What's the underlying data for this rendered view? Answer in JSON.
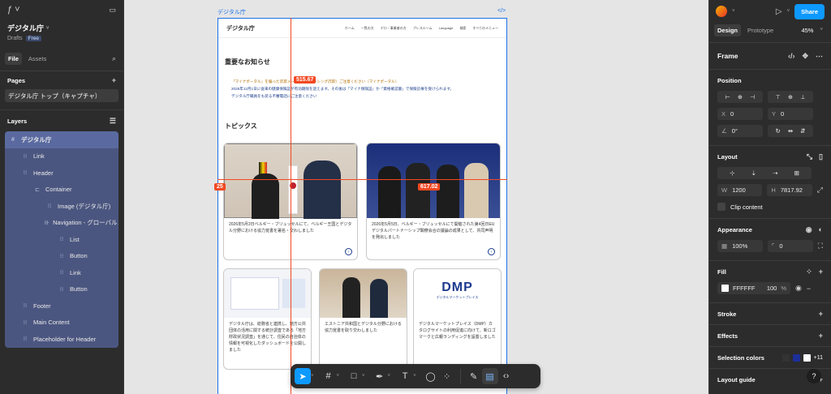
{
  "left": {
    "file_name": "デジタル庁",
    "drafts": "Drafts",
    "plan_badge": "Free",
    "tabs": [
      "File",
      "Assets"
    ],
    "pages_label": "Pages",
    "page_item": "デジタル庁 トップ（キャプチャ）",
    "layers_label": "Layers",
    "layers": [
      {
        "name": "デジタル庁",
        "icon": "#",
        "indent": 0
      },
      {
        "name": "Link",
        "icon": "⁝⁝",
        "indent": 1
      },
      {
        "name": "Header",
        "icon": "⁝⁝",
        "indent": 1
      },
      {
        "name": "Container",
        "icon": "⊏",
        "indent": 2
      },
      {
        "name": "Image (デジタル庁)",
        "icon": "⁝⁝",
        "indent": 3
      },
      {
        "name": "Navigation - グローバルメ",
        "icon": "⊪",
        "indent": 3
      },
      {
        "name": "List",
        "icon": "⁝⁝",
        "indent": 4
      },
      {
        "name": "Button",
        "icon": "⁝⁝",
        "indent": 4
      },
      {
        "name": "Link",
        "icon": "⁝⁝",
        "indent": 4
      },
      {
        "name": "Button",
        "icon": "⁝⁝",
        "indent": 4
      },
      {
        "name": "Footer",
        "icon": "⁝⁝",
        "indent": 1
      },
      {
        "name": "Main Content",
        "icon": "⁝⁝",
        "indent": 1
      },
      {
        "name": "Placeholder for Header",
        "icon": "⁝⁝",
        "indent": 1
      }
    ]
  },
  "canvas": {
    "frame_label": "デジタル庁",
    "code_icon": "</>",
    "measure_top": "515.67",
    "measure_left": "25",
    "measure_right": "617.02",
    "site": {
      "logo": "デジタル庁",
      "nav": [
        "ホーム",
        "一覧の方",
        "デロ・事業者の方",
        "プレスルーム",
        "Language",
        "検索",
        "すべてのメニュー"
      ],
      "notice_heading": "重要なお知らせ",
      "notice_lines": [
        "「マイナポータル」を騙った詐欺メールに（フィッシング詐欺）ご注意ください（マイナポータル）",
        "2025年12月1日に従来の健康保険証が有効期限を迎えます。その後は「マイナ保険証」か「資格確認書」で保険診療を受けられます。",
        "デジタル庁職員をも装る不審電話にご注意ください"
      ],
      "topics_heading": "トピックス",
      "cards": [
        {
          "caption": "2026年5月2日ベルギー・ブリュッセルにて、ベルギー王国とデジタル分野における協力覚書を署名・交わしました"
        },
        {
          "caption": "2026年5月5日、ベルギー・ブリュッセルにて開催された第4回日EUデジタルパートナーシップ閣僚会合の議論の成果として、共同声明を発出しました"
        },
        {
          "caption": "デジタル庁は、総務省と連携し、地方公共団体の活用に関する統計調査である「地方財政状況調査」を通じて、住民の自治体の情報を可視化したダッシュボードを公開しました"
        },
        {
          "caption": "エストニア共和国とデジタル分野における協力覚書を取り交わしました"
        },
        {
          "caption": "デジタルマーケットプレイス（DMP）カタログサイトの利用促進に向けて、新ロゴマークと広報ランディングを設置しました"
        }
      ],
      "dmp_logo": "DMP",
      "dmp_sub": "デジタルマーケットプレイス"
    }
  },
  "right": {
    "tabs": [
      "Design",
      "Prototype"
    ],
    "zoom": "45%",
    "share_label": "Share",
    "frame_label": "Frame",
    "position_label": "Position",
    "x_label": "X",
    "x_value": "0",
    "y_label": "Y",
    "y_value": "0",
    "rotation_value": "0°",
    "layout_label": "Layout",
    "w_label": "W",
    "w_value": "1200",
    "h_label": "H",
    "h_value": "7817.92",
    "clip_label": "Clip content",
    "appearance_label": "Appearance",
    "opacity_value": "100%",
    "radius_value": "0",
    "fill_label": "Fill",
    "fill_hex": "FFFFFF",
    "fill_opacity": "100",
    "fill_pct": "%",
    "stroke_label": "Stroke",
    "effects_label": "Effects",
    "selection_colors_label": "Selection colors",
    "selection_more": "+11",
    "layout_guide_label": "Layout guide",
    "help_label": "?"
  },
  "colors": {
    "accent": "#0d99ff",
    "selection": "#1a73e8",
    "measure": "#f24822"
  }
}
